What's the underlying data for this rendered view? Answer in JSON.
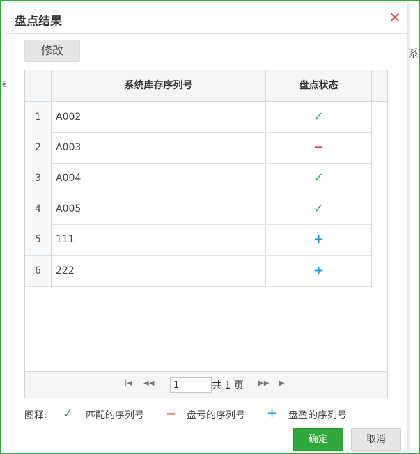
{
  "background": {
    "right_fragment": "系",
    "left_fragment": "号"
  },
  "dialog": {
    "title": "盘点结果",
    "close_glyph": "✕",
    "edit_button": "修改"
  },
  "table": {
    "columns": [
      "系统库存序列号",
      "盘点状态"
    ],
    "rows": [
      {
        "num": "1",
        "serial": "A002",
        "status": "match",
        "glyph": "✓"
      },
      {
        "num": "2",
        "serial": "A003",
        "status": "loss",
        "glyph": "−"
      },
      {
        "num": "3",
        "serial": "A004",
        "status": "match",
        "glyph": "✓"
      },
      {
        "num": "4",
        "serial": "A005",
        "status": "match",
        "glyph": "✓"
      },
      {
        "num": "5",
        "serial": "111",
        "status": "gain",
        "glyph": "+"
      },
      {
        "num": "6",
        "serial": "222",
        "status": "gain",
        "glyph": "+"
      }
    ]
  },
  "pager": {
    "first": "|◀",
    "prev": "◀◀",
    "page_value": "1",
    "total_label": "共 1 页",
    "next": "▶▶",
    "last": "▶|"
  },
  "legend": {
    "label": "图释:",
    "match_glyph": "✓",
    "match_text": "匹配的序列号",
    "loss_glyph": "−",
    "loss_text": "盘亏的序列号",
    "gain_glyph": "+",
    "gain_text": "盘盈的序列号"
  },
  "footer": {
    "confirm": "确定",
    "cancel": "取消"
  },
  "colors": {
    "accent": "#2fa83c",
    "match": "#2bad4a",
    "loss": "#e23b3b",
    "gain": "#1a9be0"
  }
}
